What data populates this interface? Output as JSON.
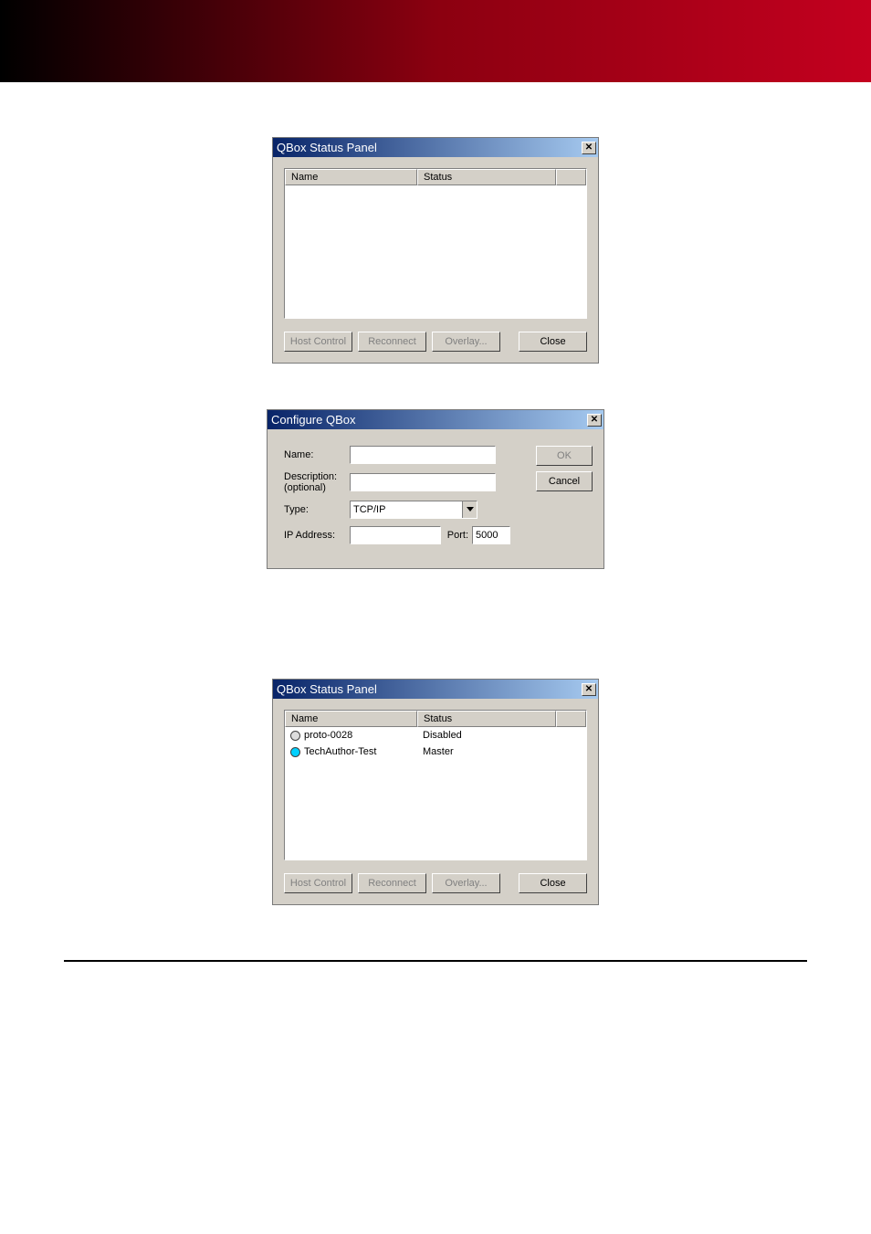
{
  "panel1": {
    "title": "QBox Status Panel",
    "columns": {
      "name": "Name",
      "status": "Status"
    },
    "rows": [],
    "buttons": {
      "host_control": "Host Control",
      "reconnect": "Reconnect",
      "overlay": "Overlay...",
      "close": "Close"
    }
  },
  "configure": {
    "title": "Configure QBox",
    "labels": {
      "name": "Name:",
      "description_line1": "Description:",
      "description_line2": "(optional)",
      "type": "Type:",
      "ip": "IP Address:",
      "port": "Port:"
    },
    "values": {
      "name": "",
      "description": "",
      "type": "TCP/IP",
      "ip": "",
      "port": "5000"
    },
    "buttons": {
      "ok": "OK",
      "cancel": "Cancel"
    }
  },
  "panel2": {
    "title": "QBox Status Panel",
    "columns": {
      "name": "Name",
      "status": "Status"
    },
    "rows": [
      {
        "name": "proto-0028",
        "status": "Disabled",
        "color": "grey"
      },
      {
        "name": "TechAuthor-Test",
        "status": "Master",
        "color": "cyan"
      }
    ],
    "buttons": {
      "host_control": "Host Control",
      "reconnect": "Reconnect",
      "overlay": "Overlay...",
      "close": "Close"
    }
  }
}
